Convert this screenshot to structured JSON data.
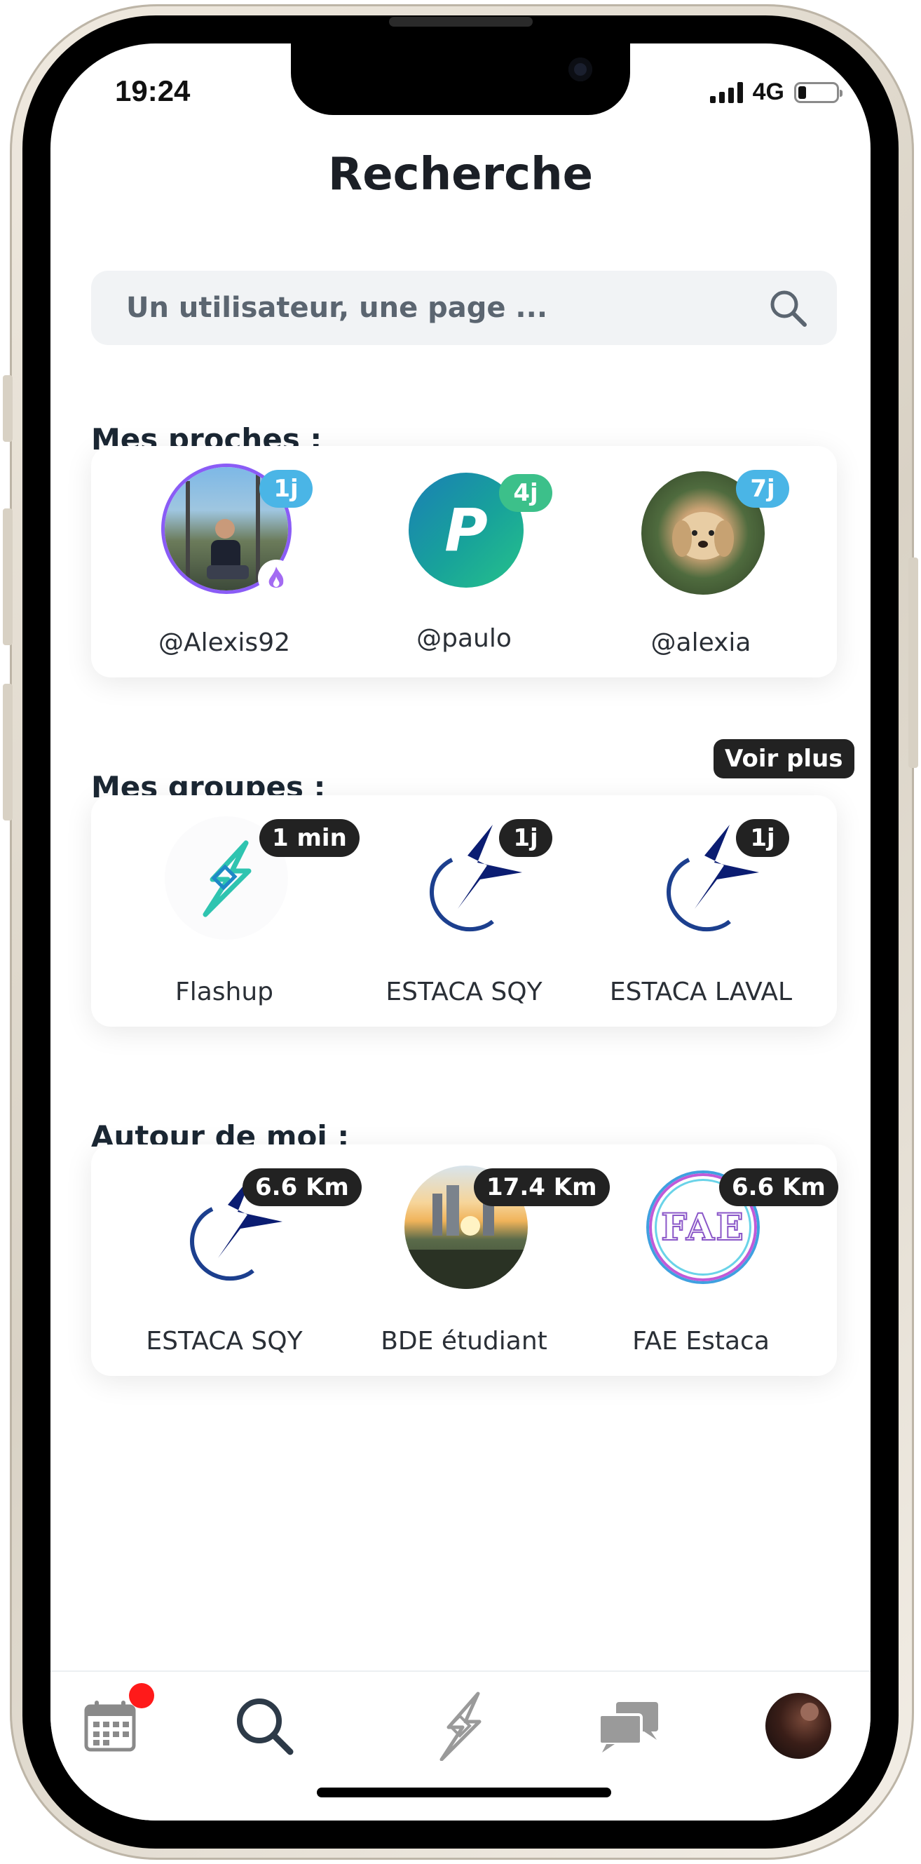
{
  "status_bar": {
    "time": "19:24",
    "network": "4G"
  },
  "page": {
    "title": "Recherche"
  },
  "search": {
    "placeholder": "Un utilisateur, une page ..."
  },
  "sections": {
    "proches": {
      "title": "Mes proches :",
      "items": [
        {
          "label": "@Alexis92",
          "badge": "1j",
          "badge_color": "#4ab5e6"
        },
        {
          "label": "@paulo",
          "badge": "4j",
          "badge_color": "#3cc08a"
        },
        {
          "label": "@alexia",
          "badge": "7j",
          "badge_color": "#4ab5e6"
        }
      ]
    },
    "groupes": {
      "title": "Mes groupes :",
      "more_label": "Voir plus",
      "items": [
        {
          "label": "Flashup",
          "badge": "1 min"
        },
        {
          "label": "ESTACA SQY",
          "badge": "1j"
        },
        {
          "label": "ESTACA LAVAL",
          "badge": "1j"
        }
      ]
    },
    "autour": {
      "title": "Autour de moi :",
      "items": [
        {
          "label": "ESTACA SQY",
          "badge": "6.6 Km"
        },
        {
          "label": "BDE étudiant",
          "badge": "17.4 Km"
        },
        {
          "label": "FAE Estaca",
          "badge": "6.6 Km"
        }
      ]
    }
  },
  "avatar_letters": {
    "paulo": "P",
    "fae": "FAE"
  },
  "tabbar": {
    "items": [
      {
        "icon": "calendar-icon",
        "has_notification": true
      },
      {
        "icon": "search-icon",
        "active": true
      },
      {
        "icon": "flashup-icon"
      },
      {
        "icon": "chat-icon"
      },
      {
        "icon": "profile-avatar"
      }
    ]
  },
  "colors": {
    "accent_blue": "#4ab5e6",
    "accent_green": "#3cc08a",
    "badge_dark": "#222222",
    "notification": "#ff1a1a"
  }
}
